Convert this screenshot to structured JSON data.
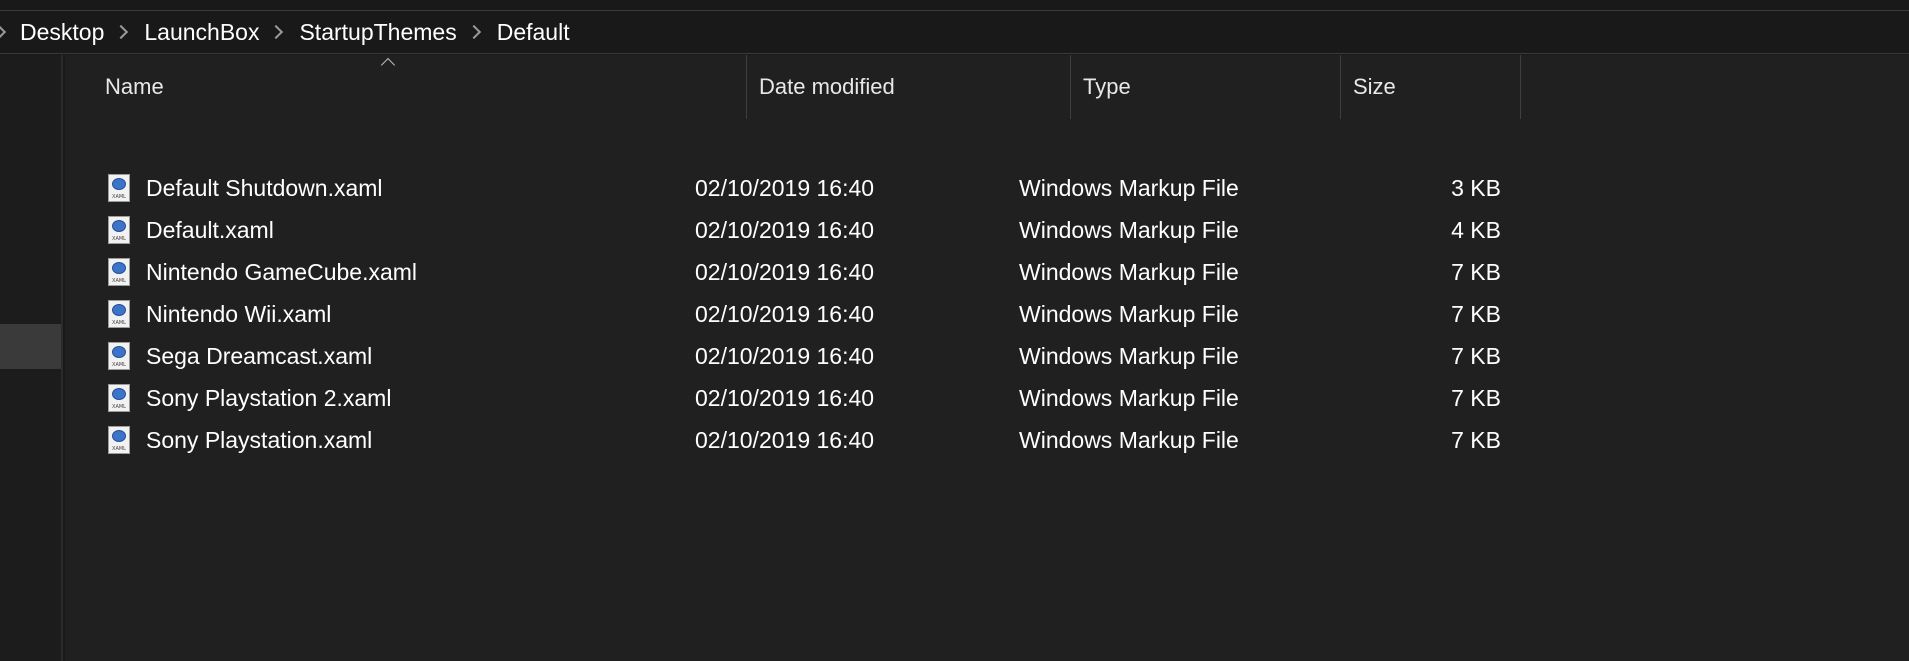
{
  "breadcrumb": [
    "Desktop",
    "LaunchBox",
    "StartupThemes",
    "Default"
  ],
  "columns": {
    "name": "Name",
    "date": "Date modified",
    "type": "Type",
    "size": "Size"
  },
  "icon_tag": "XAML",
  "files": [
    {
      "name": "Default Shutdown.xaml",
      "date": "02/10/2019 16:40",
      "type": "Windows Markup File",
      "size": "3 KB"
    },
    {
      "name": "Default.xaml",
      "date": "02/10/2019 16:40",
      "type": "Windows Markup File",
      "size": "4 KB"
    },
    {
      "name": "Nintendo GameCube.xaml",
      "date": "02/10/2019 16:40",
      "type": "Windows Markup File",
      "size": "7 KB"
    },
    {
      "name": "Nintendo Wii.xaml",
      "date": "02/10/2019 16:40",
      "type": "Windows Markup File",
      "size": "7 KB"
    },
    {
      "name": "Sega Dreamcast.xaml",
      "date": "02/10/2019 16:40",
      "type": "Windows Markup File",
      "size": "7 KB"
    },
    {
      "name": "Sony Playstation 2.xaml",
      "date": "02/10/2019 16:40",
      "type": "Windows Markup File",
      "size": "7 KB"
    },
    {
      "name": "Sony Playstation.xaml",
      "date": "02/10/2019 16:40",
      "type": "Windows Markup File",
      "size": "7 KB"
    }
  ]
}
